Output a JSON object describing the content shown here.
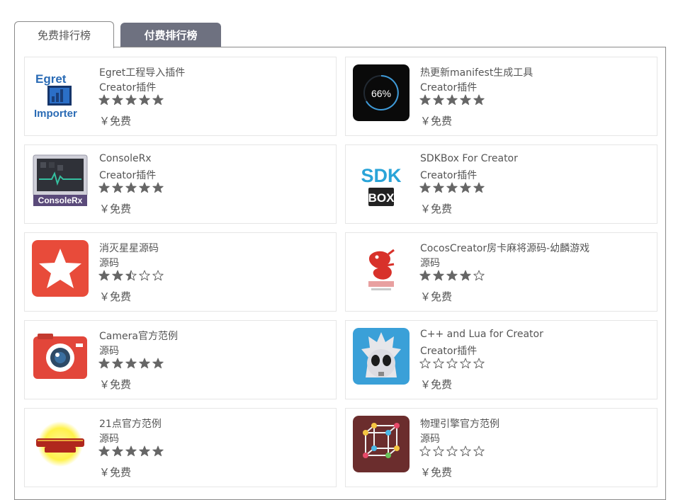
{
  "tabs": [
    {
      "label": "免费排行榜",
      "active": true
    },
    {
      "label": "付费排行榜",
      "active": false
    }
  ],
  "colors": {
    "tab_inactive": "#6e7180",
    "star": "#666666",
    "border": "#e6e6e6"
  },
  "items": [
    {
      "name": "Egret工程导入插件",
      "category": "Creator插件",
      "rating": 5,
      "price": "￥免费",
      "icon": "egret-importer-icon"
    },
    {
      "name": "热更新manifest生成工具",
      "category": "Creator插件",
      "rating": 5,
      "price": "￥免费",
      "icon": "progress-66-icon",
      "icon_text": "66%"
    },
    {
      "name": "ConsoleRx",
      "category": "Creator插件",
      "rating": 5,
      "price": "￥免费",
      "icon": "consolerx-icon"
    },
    {
      "name": "SDKBox For Creator",
      "category": "Creator插件",
      "rating": 5,
      "price": "￥免费",
      "icon": "sdkbox-icon"
    },
    {
      "name": "消灭星星源码",
      "category": "源码",
      "rating": 2.5,
      "price": "￥免费",
      "icon": "star-game-icon"
    },
    {
      "name": "CocosCreator房卡麻将源码-幼麟游戏",
      "category": "源码",
      "rating": 4,
      "price": "￥免费",
      "icon": "youlin-dragon-icon"
    },
    {
      "name": "Camera官方范例",
      "category": "源码",
      "rating": 5,
      "price": "￥免费",
      "icon": "camera-icon"
    },
    {
      "name": "C++ and Lua for Creator",
      "category": "Creator插件",
      "rating": 0,
      "price": "￥免费",
      "icon": "cocos-mascot-icon"
    },
    {
      "name": "21点官方范例",
      "category": "源码",
      "rating": 5,
      "price": "￥免费",
      "icon": "blackjack-icon"
    },
    {
      "name": "物理引擎官方范例",
      "category": "源码",
      "rating": 0,
      "price": "￥免费",
      "icon": "physics-cube-icon"
    }
  ]
}
